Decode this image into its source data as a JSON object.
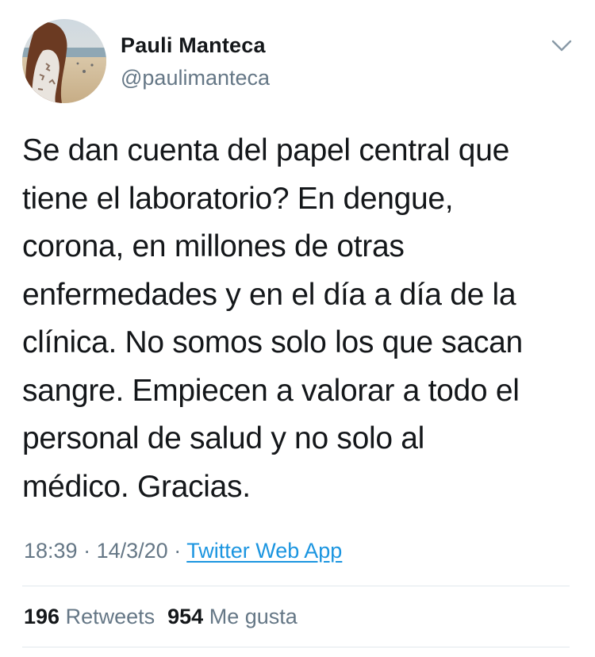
{
  "author": {
    "display_name": "Pauli Manteca",
    "handle": "@paulimanteca"
  },
  "tweet": {
    "lines": [
      "Se dan cuenta del papel central que",
      "tiene el laboratorio? En dengue,",
      "corona, en millones de otras",
      "enfermedades y en el día a día de la",
      "clínica. No somos solo los que sacan",
      "sangre. Empiecen a valorar a todo el",
      "personal de salud y no solo al",
      "médico. Gracias."
    ],
    "time": "18:39",
    "date": "14/3/20",
    "separator": "·",
    "source": "Twitter Web App"
  },
  "stats": {
    "retweets_count": "196",
    "retweets_label": "Retweets",
    "likes_count": "954",
    "likes_label": "Me gusta"
  },
  "icons": {
    "menu": "chevron-down-icon"
  },
  "colors": {
    "text": "#14171a",
    "secondary": "#657786",
    "link": "#1b95e0",
    "divider": "#e1e8ed"
  }
}
